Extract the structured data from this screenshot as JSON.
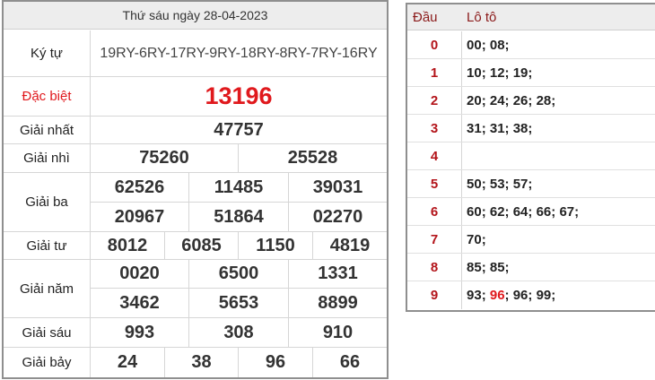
{
  "results": {
    "title": "Thứ sáu ngày 28-04-2023",
    "kytu": {
      "label": "Ký tự",
      "value": "19RY-6RY-17RY-9RY-18RY-8RY-7RY-16RY"
    },
    "dac_biet": {
      "label": "Đặc biệt",
      "values": [
        "13196"
      ]
    },
    "giai_nhat": {
      "label": "Giải nhất",
      "values": [
        "47757"
      ]
    },
    "giai_nhi": {
      "label": "Giải nhì",
      "values": [
        "75260",
        "25528"
      ]
    },
    "giai_ba": {
      "label": "Giải ba",
      "values": [
        "62526",
        "11485",
        "39031",
        "20967",
        "51864",
        "02270"
      ]
    },
    "giai_tu": {
      "label": "Giải tư",
      "values": [
        "8012",
        "6085",
        "1150",
        "4819"
      ]
    },
    "giai_nam": {
      "label": "Giải năm",
      "values": [
        "0020",
        "6500",
        "1331",
        "3462",
        "5653",
        "8899"
      ]
    },
    "giai_sau": {
      "label": "Giải sáu",
      "values": [
        "993",
        "308",
        "910"
      ]
    },
    "giai_bay": {
      "label": "Giải bảy",
      "values": [
        "24",
        "38",
        "96",
        "66"
      ]
    }
  },
  "loto": {
    "header_dau": "Đầu",
    "header_loto": "Lô tô",
    "rows": [
      {
        "dau": "0",
        "numbers": [
          "00",
          "08"
        ]
      },
      {
        "dau": "1",
        "numbers": [
          "10",
          "12",
          "19"
        ]
      },
      {
        "dau": "2",
        "numbers": [
          "20",
          "24",
          "26",
          "28"
        ]
      },
      {
        "dau": "3",
        "numbers": [
          "31",
          "31",
          "38"
        ]
      },
      {
        "dau": "4",
        "numbers": []
      },
      {
        "dau": "5",
        "numbers": [
          "50",
          "53",
          "57"
        ]
      },
      {
        "dau": "6",
        "numbers": [
          "60",
          "62",
          "64",
          "66",
          "67"
        ]
      },
      {
        "dau": "7",
        "numbers": [
          "70"
        ]
      },
      {
        "dau": "8",
        "numbers": [
          "85",
          "85"
        ]
      },
      {
        "dau": "9",
        "numbers": [
          "93",
          "96",
          "96",
          "99"
        ],
        "highlight_index": 1
      }
    ]
  },
  "colors": {
    "special": "#e0191d",
    "dau": "#b3141a",
    "header_bg": "#ededed"
  }
}
